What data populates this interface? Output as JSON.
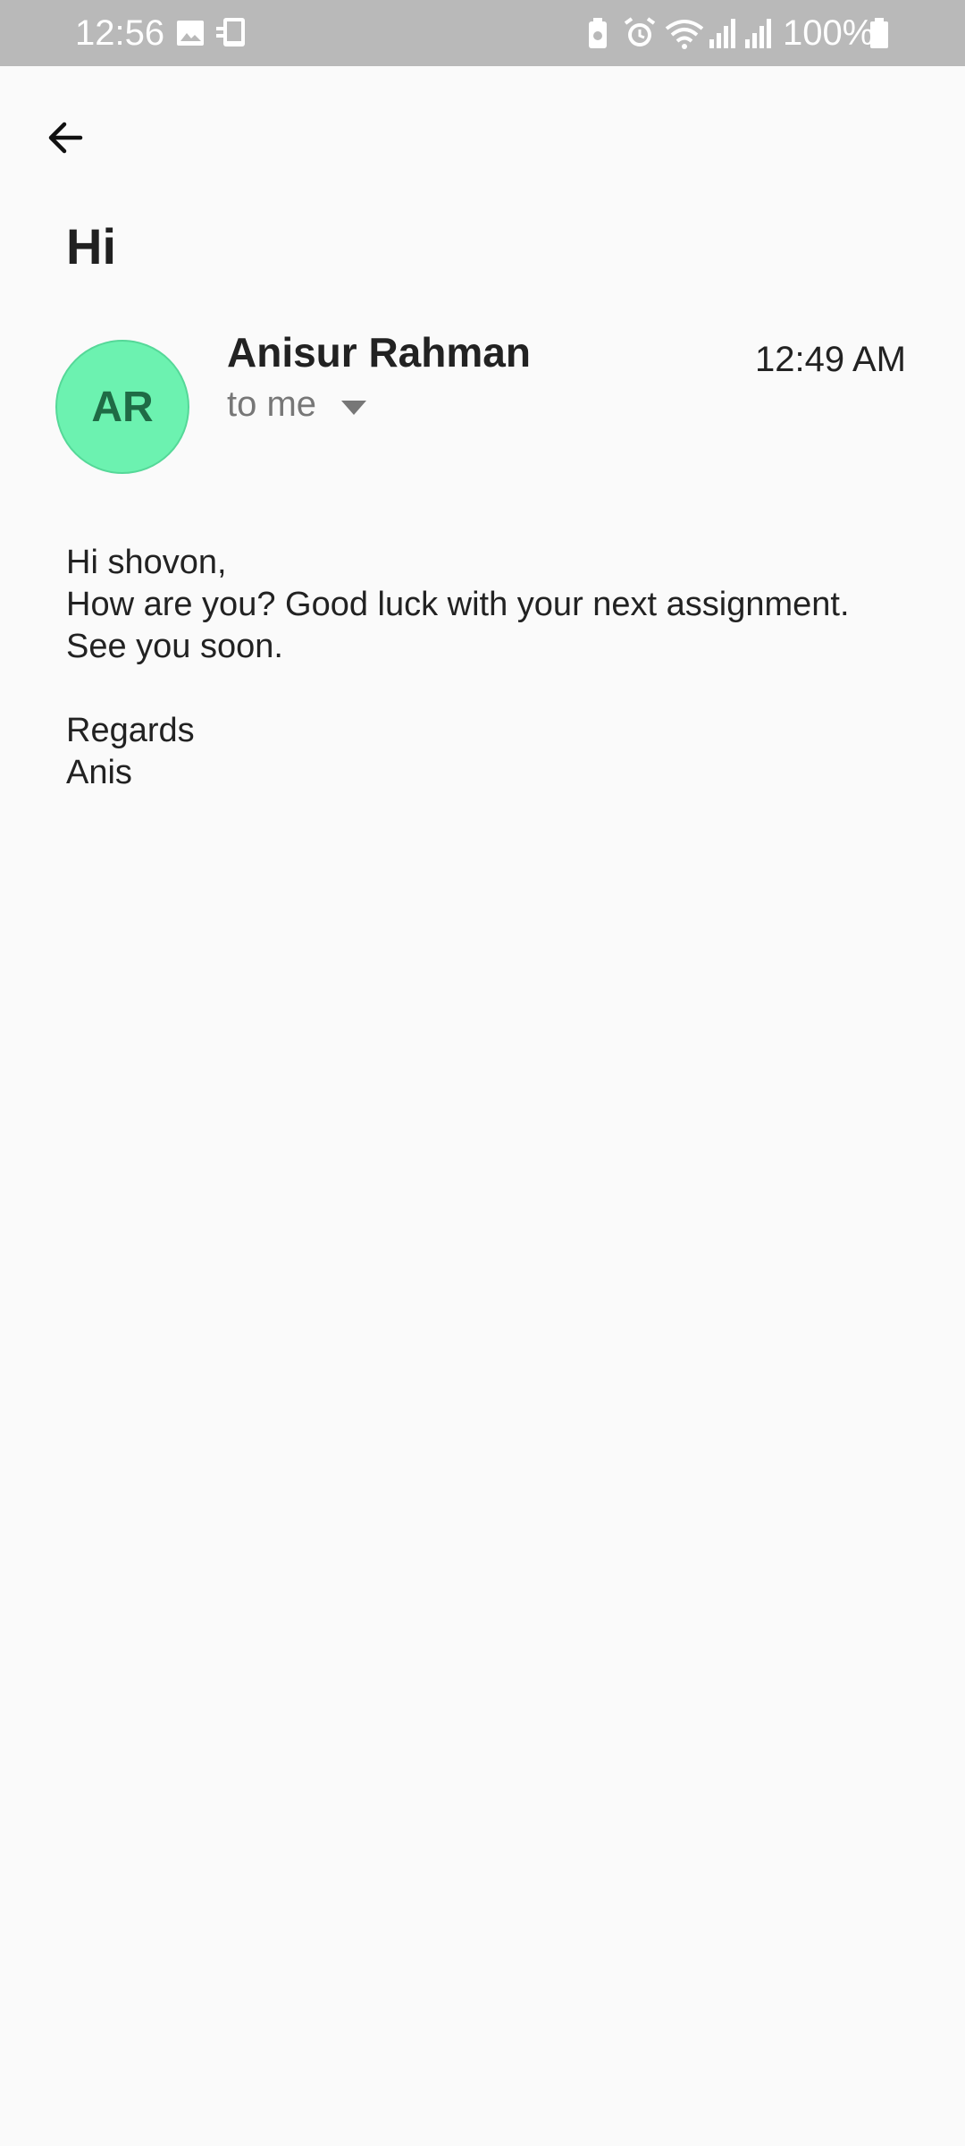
{
  "status_bar": {
    "time": "12:56",
    "battery": "100%",
    "icons": [
      "image-icon",
      "screen-mirror-icon",
      "battery-saver-icon",
      "alarm-icon",
      "wifi-icon",
      "signal-icon",
      "signal-icon",
      "battery-icon"
    ],
    "background": "#b9b9b9"
  },
  "email": {
    "subject": "Hi",
    "sender": {
      "initials": "AR",
      "name": "Anisur Rahman",
      "avatar_color": "#6cf2b0"
    },
    "recipient_label": "to me",
    "time": "12:49 AM",
    "body_lines": [
      "Hi shovon,",
      "How are you? Good luck with your next assignment.",
      "See you soon.",
      "",
      "Regards",
      "Anis"
    ]
  }
}
